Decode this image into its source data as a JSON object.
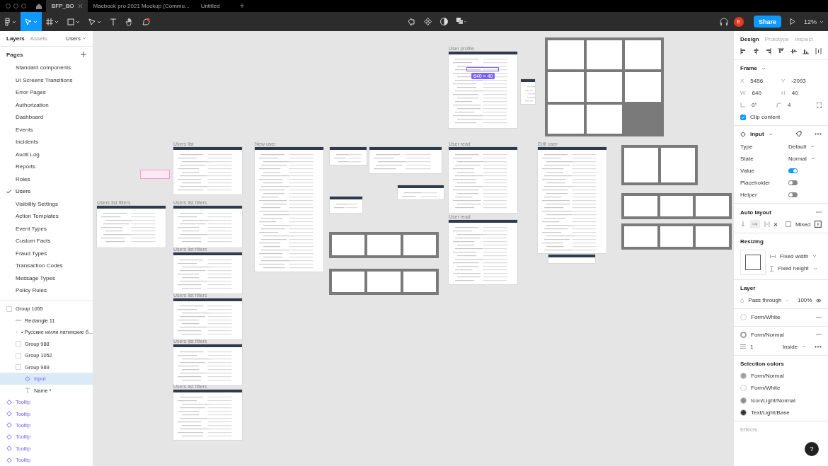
{
  "tabs": [
    {
      "label": "BFP_BO",
      "selected": true
    },
    {
      "label": "Macbook pro 2021 Mockup (Commu...",
      "selected": false
    },
    {
      "label": "Untitled",
      "selected": false
    }
  ],
  "toolbar": {
    "avatar": "E",
    "share": "Share",
    "zoom": "12%"
  },
  "left_panel": {
    "tabs": [
      {
        "label": "Layers",
        "selected": true
      },
      {
        "label": "Assets",
        "selected": false
      }
    ],
    "page_menu": "Users",
    "pages_title": "Pages",
    "pages": [
      {
        "label": "Standard components",
        "selected": false
      },
      {
        "label": "UI Screens Transitions",
        "selected": false
      },
      {
        "label": "Error Pages",
        "selected": false
      },
      {
        "label": "Authorization",
        "selected": false
      },
      {
        "label": "Dashboard",
        "selected": false
      },
      {
        "label": "Events",
        "selected": false
      },
      {
        "label": "Incidents",
        "selected": false
      },
      {
        "label": "Audit Log",
        "selected": false
      },
      {
        "label": "Reports",
        "selected": false
      },
      {
        "label": "Roles",
        "selected": false
      },
      {
        "label": "Users",
        "selected": true
      },
      {
        "label": "Visibility Settings",
        "selected": false
      },
      {
        "label": "Action Templates",
        "selected": false
      },
      {
        "label": "Event Types",
        "selected": false
      },
      {
        "label": "Custom Facts",
        "selected": false
      },
      {
        "label": "Fraud Types",
        "selected": false
      },
      {
        "label": "Transaction Codes",
        "selected": false
      },
      {
        "label": "Message Types",
        "selected": false
      },
      {
        "label": "Policy Rules",
        "selected": false
      }
    ],
    "layers": [
      {
        "name": "Group 1055",
        "kind": "group",
        "selected": false,
        "children": [
          {
            "name": "Rectangle 11",
            "kind": "line",
            "selected": false
          },
          {
            "name": "• Русские и/или латинские б...",
            "kind": "text",
            "selected": false
          },
          {
            "name": "Group 988",
            "kind": "group",
            "selected": false
          },
          {
            "name": "Group 1052",
            "kind": "group",
            "selected": false
          },
          {
            "name": "Group 989",
            "kind": "group",
            "selected": false,
            "children": [
              {
                "name": "Input",
                "kind": "component",
                "selected": true
              },
              {
                "name": "Name *",
                "kind": "text",
                "selected": false
              }
            ]
          }
        ]
      },
      {
        "name": "Tooltip",
        "kind": "component",
        "selected": false
      },
      {
        "name": "Tooltip",
        "kind": "component",
        "selected": false
      },
      {
        "name": "Tooltip",
        "kind": "component",
        "selected": false
      },
      {
        "name": "Tooltip",
        "kind": "component",
        "selected": false
      },
      {
        "name": "Tooltip",
        "kind": "component",
        "selected": false
      },
      {
        "name": "Tooltip",
        "kind": "component",
        "selected": false
      }
    ]
  },
  "canvas": {
    "selection_size": "640 × 40",
    "frames": [
      {
        "kind": "page",
        "label": "User profile"
      },
      {
        "kind": "page",
        "label": "Users list"
      },
      {
        "kind": "page",
        "label": "Users list filters"
      },
      {
        "kind": "page",
        "label": "Users list filters"
      },
      {
        "kind": "page",
        "label": "Users list filters"
      },
      {
        "kind": "page",
        "label": "Users list filters"
      },
      {
        "kind": "page",
        "label": "Users list filters"
      },
      {
        "kind": "page",
        "label": "Users list filters"
      },
      {
        "kind": "page",
        "label": "New user"
      },
      {
        "kind": "page",
        "label": "User read"
      },
      {
        "kind": "page",
        "label": "User read"
      },
      {
        "kind": "page",
        "label": "Edit user"
      },
      {
        "kind": "page"
      },
      {
        "kind": "page"
      },
      {
        "kind": "page"
      },
      {
        "kind": "page"
      },
      {
        "kind": "page"
      },
      {
        "kind": "page"
      },
      {
        "kind": "group"
      },
      {
        "kind": "group"
      },
      {
        "kind": "group"
      },
      {
        "kind": "group"
      },
      {
        "kind": "group"
      },
      {
        "kind": "group"
      }
    ]
  },
  "right_panel": {
    "tabs": [
      {
        "label": "Design",
        "selected": true
      },
      {
        "label": "Prototype",
        "selected": false
      },
      {
        "label": "Inspect",
        "selected": false
      }
    ],
    "frame": {
      "title": "Frame",
      "fields": [
        {
          "label": "X",
          "value": "5456"
        },
        {
          "label": "Y",
          "value": "-2093"
        },
        {
          "label": "W",
          "value": "640"
        },
        {
          "label": "H",
          "value": "40"
        }
      ],
      "rotation": "0°",
      "radius": "4",
      "clip_content": {
        "label": "Clip content",
        "checked": true
      }
    },
    "component": {
      "name": "input",
      "properties": [
        {
          "kind": "select",
          "label": "Type",
          "value": "Default"
        },
        {
          "kind": "select",
          "label": "State",
          "value": "Normal"
        },
        {
          "kind": "toggle",
          "label": "Value",
          "on": true
        },
        {
          "kind": "toggle",
          "label": "Placeholder",
          "on": false
        },
        {
          "kind": "toggle",
          "label": "Helper",
          "on": false
        }
      ]
    },
    "auto_layout": {
      "title": "Auto layout",
      "spacing": "8",
      "padding": "Mixed"
    },
    "resizing": {
      "title": "Resizing",
      "width": "Fixed width",
      "height": "Fixed height"
    },
    "layer": {
      "title": "Layer",
      "blend": "Pass through",
      "opacity": "100%"
    },
    "fill": {
      "style": "Form/White"
    },
    "stroke": {
      "style": "Form/Normal",
      "weight": "1",
      "position": "Inside"
    },
    "selection_colors": {
      "title": "Selection colors",
      "items": [
        {
          "name": "Form/Normal",
          "color": "#a0a0a0"
        },
        {
          "name": "Form/White",
          "color": "#ffffff"
        },
        {
          "name": "Icon/Light/Normal",
          "color": "#8c8c8c"
        },
        {
          "name": "Text/Light/Base",
          "color": "#333333"
        }
      ]
    },
    "effects": {
      "title": "Effects"
    },
    "help": "?"
  }
}
